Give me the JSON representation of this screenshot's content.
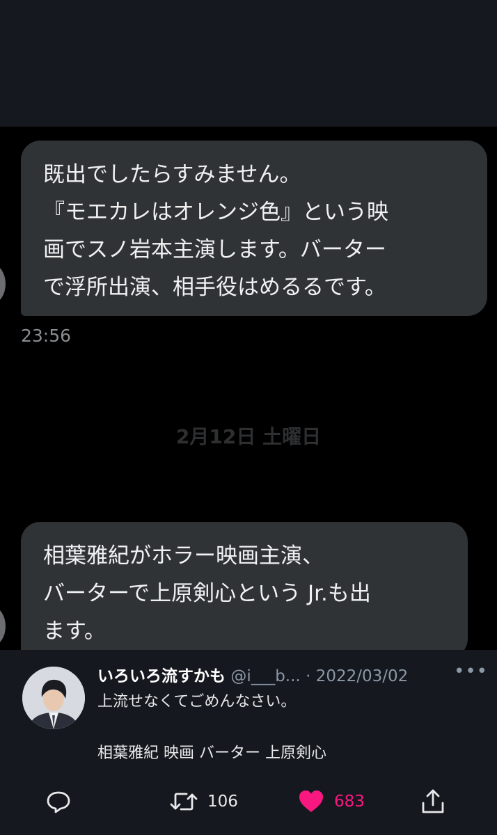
{
  "dm": {
    "message1": "既出でしたらすみません。\n『モエカレはオレンジ色』という映\n画でスノ岩本主演します。バーター\nで浮所出演、相手役はめるるです。",
    "time1": "23:56",
    "date_separator": "2月12日 土曜日",
    "message2": "相葉雅紀がホラー映画主演、\nバーターで上原剣心という Jr.も出\nます。"
  },
  "tweet": {
    "display_name": "いろいろ流すかも",
    "handle": "@i___b...",
    "separator": "·",
    "date": "2022/03/02",
    "more_icon": "more-icon",
    "text": "上流せなくてごめんなさい。",
    "tags": "相葉雅紀 映画 バーター 上原剣心",
    "actions": {
      "reply_icon": "reply-icon",
      "retweet_icon": "retweet-icon",
      "retweet_count": "106",
      "like_icon": "heart-icon",
      "like_count": "683",
      "share_icon": "share-icon"
    }
  },
  "colors": {
    "background": "#15181e",
    "dm_background": "#000000",
    "bubble": "#2f3336",
    "muted": "#8b98a5",
    "like": "#f91880"
  }
}
